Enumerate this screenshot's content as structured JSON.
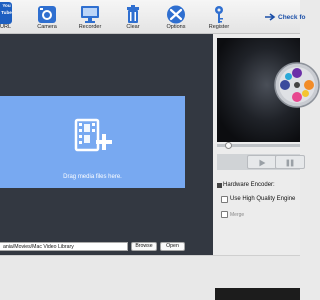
{
  "toolbar": {
    "youtube": {
      "logo_top": "You",
      "logo_bottom": "Tube",
      "label": "URL"
    },
    "buttons": [
      {
        "label": "Camera",
        "icon": "camera-icon"
      },
      {
        "label": "Recorder",
        "icon": "monitor-icon"
      },
      {
        "label": "Clear",
        "icon": "trash-icon"
      },
      {
        "label": "Options",
        "icon": "tools-icon"
      },
      {
        "label": "Register",
        "icon": "key-icon"
      }
    ],
    "check_update": "Check fo"
  },
  "drop": {
    "text": "Drag media files here."
  },
  "player": {
    "progress": 0.1
  },
  "settings": {
    "hardware_encoder": "Hardware Encoder:",
    "high_quality": "Use High Quality Engine",
    "merge": "Merge"
  },
  "output": {
    "path": "ania/Movies/Mac Video Library",
    "browse": "Browse",
    "open": "Open"
  },
  "colors": {
    "accent": "#1d5fc1",
    "drop_zone": "#78a9f1",
    "drop_bg": "#333841"
  }
}
